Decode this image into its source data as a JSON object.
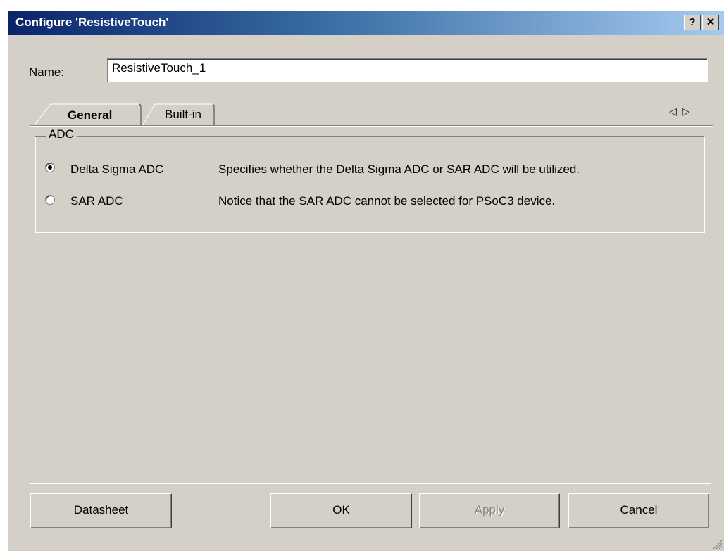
{
  "window": {
    "title": "Configure 'ResistiveTouch'",
    "help_button": "?",
    "close_button": "✕"
  },
  "name_field": {
    "label": "Name:",
    "value": "ResistiveTouch_1"
  },
  "tabs": [
    {
      "label": "General",
      "selected": true
    },
    {
      "label": "Built-in",
      "selected": false
    }
  ],
  "tab_nav": {
    "prev": "◁",
    "next": "▷"
  },
  "adc_group": {
    "title": "ADC",
    "options": [
      {
        "label": "Delta Sigma ADC",
        "selected": true,
        "description": "Specifies whether the Delta Sigma ADC or SAR ADC will be utilized."
      },
      {
        "label": "SAR ADC",
        "selected": false,
        "description": "Notice that the SAR ADC cannot be selected for PSoC3 device."
      }
    ]
  },
  "buttons": {
    "datasheet": "Datasheet",
    "ok": "OK",
    "apply": "Apply",
    "cancel": "Cancel"
  },
  "colors": {
    "titlebar_start": "#0a246a",
    "titlebar_end": "#a6caf0",
    "face": "#d4d0c8"
  }
}
